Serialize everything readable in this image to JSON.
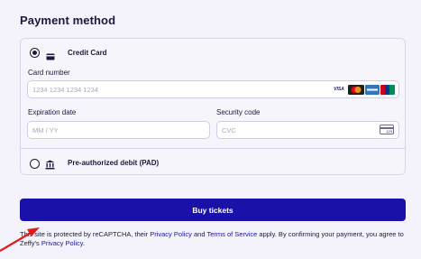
{
  "section_title": "Payment method",
  "options": {
    "credit_card": {
      "label": "Credit Card",
      "selected": true,
      "icon": "credit-card-icon"
    },
    "pad": {
      "label": "Pre-authorized debit (PAD)",
      "selected": false,
      "icon": "bank-icon"
    }
  },
  "card_number": {
    "label": "Card number",
    "placeholder": "1234 1234 1234 1234"
  },
  "brands": [
    {
      "name": "VISA",
      "icon": "visa-logo",
      "color": "#1a1f71"
    },
    {
      "name": "Mastercard",
      "icon": "mastercard-logo",
      "color": "#eb001b"
    },
    {
      "name": "Amex",
      "icon": "amex-logo",
      "color": "#2e77bc"
    },
    {
      "name": "UnionPay",
      "icon": "unionpay-logo",
      "color": "#d0021b"
    }
  ],
  "expiration": {
    "label": "Expiration date",
    "placeholder": "MM / YY"
  },
  "security": {
    "label": "Security code",
    "placeholder": "CVC",
    "icon_text": "123"
  },
  "buy_button": {
    "label": "Buy tickets"
  },
  "legal": {
    "part1": "This site is protected by reCAPTCHA, their ",
    "privacy_link": "Privacy Policy",
    "and": " and ",
    "terms_link": "Terms of Service",
    "part2": " apply. By confirming your payment, you agree to Zeffy's ",
    "zeffy_privacy_link": "Privacy Policy",
    "period": "."
  },
  "colors": {
    "accent": "#1a12a8",
    "text": "#1b1a3a",
    "arrow": "#e01b1b"
  }
}
